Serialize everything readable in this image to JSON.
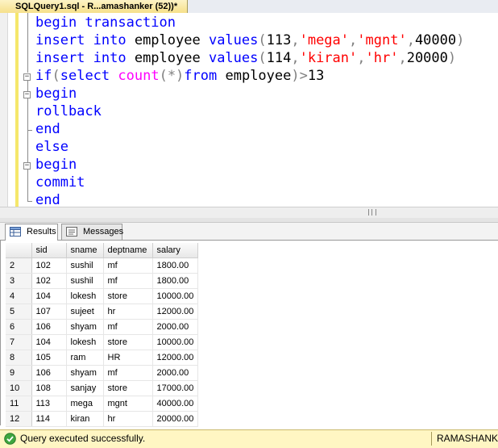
{
  "document_tab": {
    "title": "SQLQuery1.sql - R...amashanker (52))*"
  },
  "editor": {
    "lines": [
      [
        {
          "t": "begin transaction",
          "c": "kw"
        }
      ],
      [
        {
          "t": "insert into ",
          "c": "kw"
        },
        {
          "t": "employee ",
          "c": ""
        },
        {
          "t": "values",
          "c": "kw"
        },
        {
          "t": "(",
          "c": "gray"
        },
        {
          "t": "113",
          "c": ""
        },
        {
          "t": ",",
          "c": "gray"
        },
        {
          "t": "'mega'",
          "c": "str"
        },
        {
          "t": ",",
          "c": "gray"
        },
        {
          "t": "'mgnt'",
          "c": "str"
        },
        {
          "t": ",",
          "c": "gray"
        },
        {
          "t": "40000",
          "c": ""
        },
        {
          "t": ")",
          "c": "gray"
        }
      ],
      [
        {
          "t": "insert into ",
          "c": "kw"
        },
        {
          "t": "employee ",
          "c": ""
        },
        {
          "t": "values",
          "c": "kw"
        },
        {
          "t": "(",
          "c": "gray"
        },
        {
          "t": "114",
          "c": ""
        },
        {
          "t": ",",
          "c": "gray"
        },
        {
          "t": "'kiran'",
          "c": "str"
        },
        {
          "t": ",",
          "c": "gray"
        },
        {
          "t": "'hr'",
          "c": "str"
        },
        {
          "t": ",",
          "c": "gray"
        },
        {
          "t": "20000",
          "c": ""
        },
        {
          "t": ")",
          "c": "gray"
        }
      ],
      [
        {
          "t": "if",
          "c": "kw"
        },
        {
          "t": "(",
          "c": "gray"
        },
        {
          "t": "select ",
          "c": "kw"
        },
        {
          "t": "count",
          "c": "fn"
        },
        {
          "t": "(*)",
          "c": "gray"
        },
        {
          "t": "from ",
          "c": "kw"
        },
        {
          "t": "employee",
          "c": ""
        },
        {
          "t": ")>",
          "c": "gray"
        },
        {
          "t": "13",
          "c": ""
        }
      ],
      [
        {
          "t": "begin",
          "c": "kw"
        }
      ],
      [
        {
          "t": "rollback",
          "c": "kw"
        }
      ],
      [
        {
          "t": "end",
          "c": "kw"
        }
      ],
      [
        {
          "t": "else",
          "c": "kw"
        }
      ],
      [
        {
          "t": "begin",
          "c": "kw"
        }
      ],
      [
        {
          "t": "commit",
          "c": "kw"
        }
      ],
      [
        {
          "t": "end",
          "c": "kw"
        }
      ]
    ]
  },
  "result_tabs": {
    "results": "Results",
    "messages": "Messages"
  },
  "grid": {
    "columns": [
      "sid",
      "sname",
      "deptname",
      "salary"
    ],
    "rows": [
      [
        "2",
        "102",
        "sushil",
        "mf",
        "1800.00"
      ],
      [
        "3",
        "102",
        "sushil",
        "mf",
        "1800.00"
      ],
      [
        "4",
        "104",
        "lokesh",
        "store",
        "10000.00"
      ],
      [
        "5",
        "107",
        "sujeet",
        "hr",
        "12000.00"
      ],
      [
        "6",
        "106",
        "shyam",
        "mf",
        "2000.00"
      ],
      [
        "7",
        "104",
        "lokesh",
        "store",
        "10000.00"
      ],
      [
        "8",
        "105",
        "ram",
        "HR",
        "12000.00"
      ],
      [
        "9",
        "106",
        "shyam",
        "mf",
        "2000.00"
      ],
      [
        "10",
        "108",
        "sanjay",
        "store",
        "17000.00"
      ],
      [
        "11",
        "113",
        "mega",
        "mgnt",
        "40000.00"
      ],
      [
        "12",
        "114",
        "kiran",
        "hr",
        "20000.00"
      ]
    ]
  },
  "status": {
    "message": "Query executed successfully.",
    "server": "RAMASHANKE",
    "icons": {
      "status": "check-circle-icon",
      "results_tab": "grid-icon",
      "messages_tab": "message-icon"
    },
    "colors": {
      "status_bg": "#fff6c3",
      "keyword": "#0000ff",
      "string": "#ff0000",
      "function": "#ff00ff"
    }
  }
}
